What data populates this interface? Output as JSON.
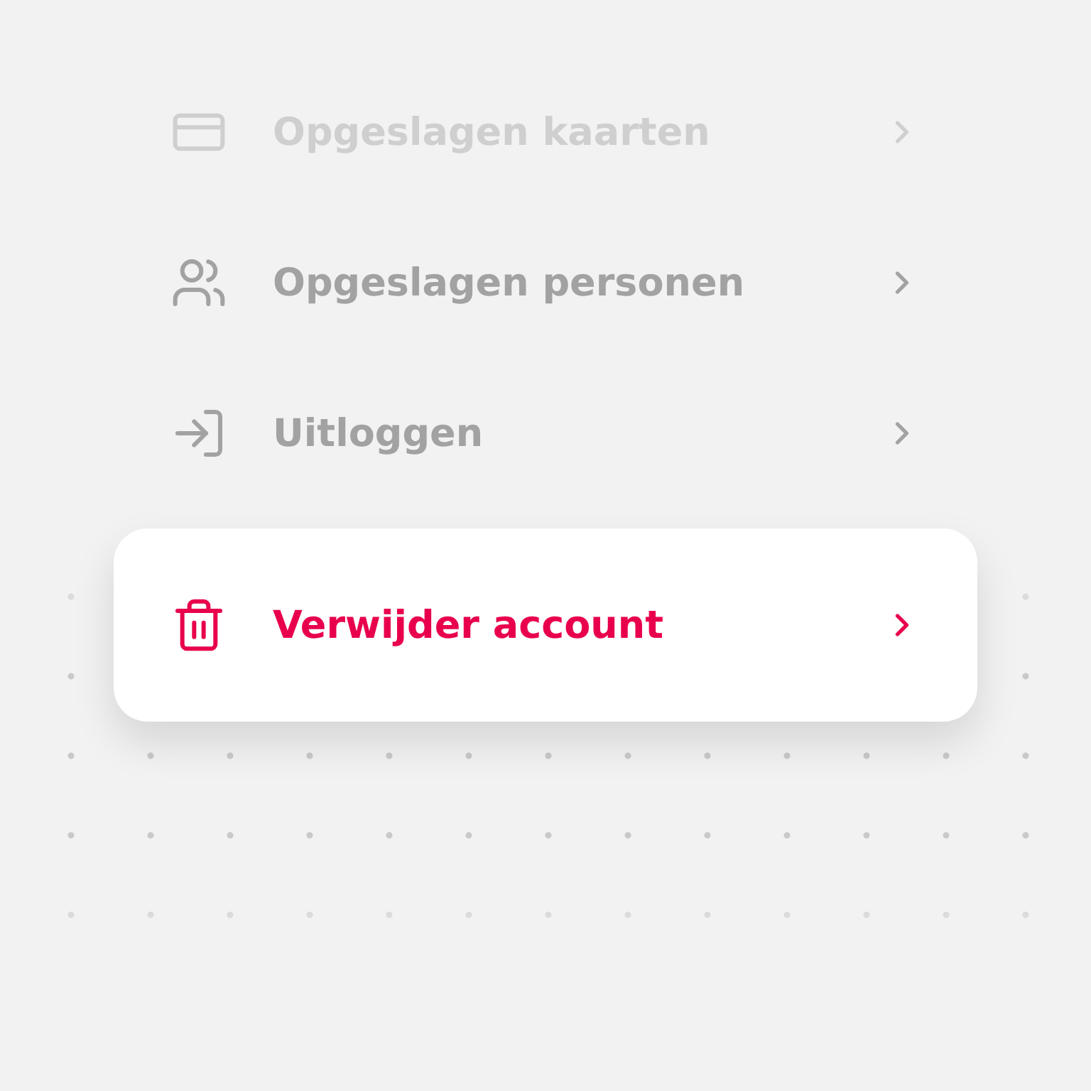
{
  "menu": [
    {
      "kind": "card",
      "label": "Opgeslagen kaarten",
      "faded": true,
      "selected": false
    },
    {
      "kind": "people",
      "label": "Opgeslagen personen",
      "faded": false,
      "selected": false
    },
    {
      "kind": "logout",
      "label": "Uitloggen",
      "faded": false,
      "selected": false
    },
    {
      "kind": "trash",
      "label": "Verwijder account",
      "faded": false,
      "selected": true
    }
  ]
}
